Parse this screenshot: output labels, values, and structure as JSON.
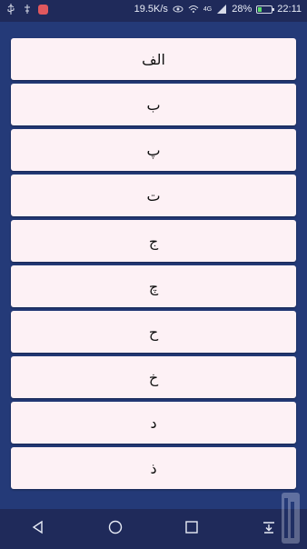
{
  "status_bar": {
    "speed": "19.5K/s",
    "network": "4G",
    "battery": "28%",
    "time": "22:11",
    "battery_level": 0.28
  },
  "alphabet": {
    "items": [
      "الف",
      "ب",
      "پ",
      "ت",
      "ج",
      "چ",
      "ح",
      "خ",
      "د",
      "ذ"
    ]
  },
  "colors": {
    "background": "#243a78",
    "item_background": "#fdf1f5",
    "bars": "#1f2a5a"
  },
  "nav_bar": {
    "icons": [
      "back-icon",
      "home-icon",
      "recents-icon",
      "notification-pull-icon"
    ]
  }
}
